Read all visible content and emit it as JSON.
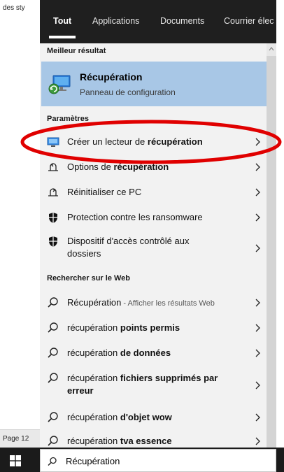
{
  "document": {
    "top_text": "des sty",
    "status_text": "Page 12"
  },
  "tabs": [
    "Tout",
    "Applications",
    "Documents",
    "Courrier élec"
  ],
  "sections": {
    "best": "Meilleur résultat",
    "settings": "Paramètres",
    "web": "Rechercher sur le Web"
  },
  "best_result": {
    "title": "Récupération",
    "subtitle": "Panneau de configuration",
    "icon": "recovery-icon"
  },
  "settings_items": [
    {
      "pre": "Créer un lecteur de ",
      "bold": "récupération",
      "icon": "monitor-icon"
    },
    {
      "pre": "Options de ",
      "bold": "récupération",
      "icon": "recovery-options-icon"
    },
    {
      "pre": "Réinitialiser ce PC",
      "bold": "",
      "icon": "reset-pc-icon"
    },
    {
      "pre": "Protection contre les ransomware",
      "bold": "",
      "icon": "shield-icon"
    },
    {
      "pre": "Dispositif d'accès contrôlé aux dossiers",
      "bold": "",
      "icon": "shield-icon"
    }
  ],
  "web_items": [
    {
      "pre": "Récupération",
      "bold": "",
      "sub": " - Afficher les résultats Web"
    },
    {
      "pre": "récupération ",
      "bold": "points permis",
      "sub": ""
    },
    {
      "pre": "récupération ",
      "bold": "de données",
      "sub": ""
    },
    {
      "pre": "récupération ",
      "bold": "fichiers supprimés par erreur",
      "sub": ""
    },
    {
      "pre": "récupération ",
      "bold": "d'objet wow",
      "sub": ""
    },
    {
      "pre": "récupération ",
      "bold": "tva essence",
      "sub": ""
    }
  ],
  "search": {
    "value": "Récupération"
  },
  "colors": {
    "highlight": "#a8c7e6",
    "annotation": "#e00000",
    "tabbar": "#1f1f1f"
  }
}
